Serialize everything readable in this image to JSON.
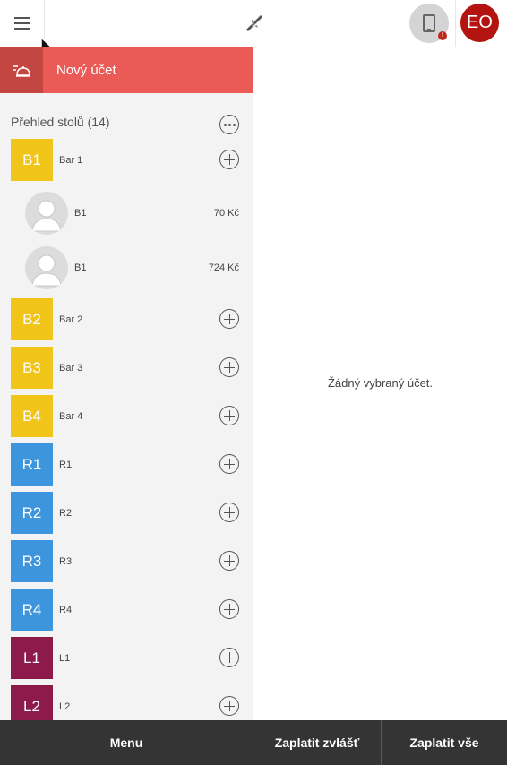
{
  "topbar": {
    "menu_icon": "hamburger-icon",
    "center_icon": "rocket-icon",
    "device_icon": "tablet-icon",
    "device_badge": "!",
    "user_initials": "EO",
    "colors": {
      "avatar": "#b4140f",
      "badge": "#c0271f"
    }
  },
  "new_account": {
    "label": "Nový účet",
    "icon": "service-bell-icon",
    "color": "#ea5a56"
  },
  "sidebar": {
    "header": "Přehled stolů (14)",
    "more_icon": "more-icon",
    "tables": [
      {
        "code": "B1",
        "name": "Bar 1",
        "color": "#f0c419"
      },
      {
        "code": "B2",
        "name": "Bar 2",
        "color": "#f0c419"
      },
      {
        "code": "B3",
        "name": "Bar 3",
        "color": "#f0c419"
      },
      {
        "code": "B4",
        "name": "Bar 4",
        "color": "#f0c419"
      },
      {
        "code": "R1",
        "name": "R1",
        "color": "#3d95dd"
      },
      {
        "code": "R2",
        "name": "R2",
        "color": "#3d95dd"
      },
      {
        "code": "R3",
        "name": "R3",
        "color": "#3d95dd"
      },
      {
        "code": "R4",
        "name": "R4",
        "color": "#3d95dd"
      },
      {
        "code": "L1",
        "name": "L1",
        "color": "#8c1b4b"
      },
      {
        "code": "L2",
        "name": "L2",
        "color": "#8c1b4b"
      }
    ],
    "accounts": [
      {
        "name": "B1",
        "amount": "70 Kč"
      },
      {
        "name": "B1",
        "amount": "724 Kč"
      }
    ]
  },
  "main": {
    "empty_message": "Žádný vybraný účet."
  },
  "bottom": {
    "menu": "Menu",
    "pay_separately": "Zaplatit zvlášť",
    "pay_all": "Zaplatit vše"
  }
}
